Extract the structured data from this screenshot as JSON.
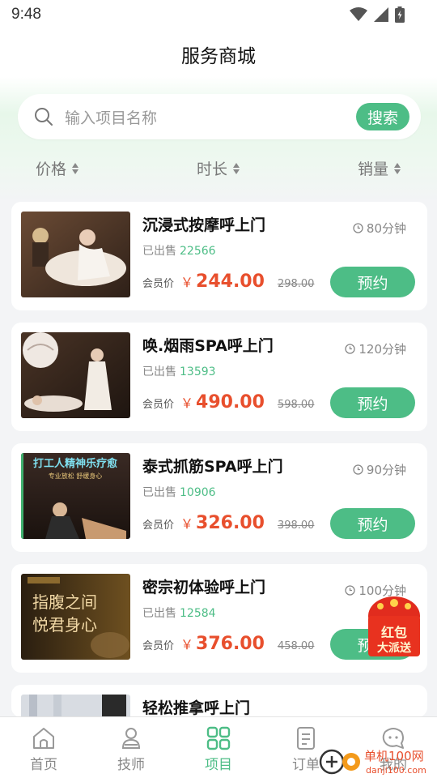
{
  "status": {
    "time": "9:48"
  },
  "header": {
    "title": "服务商城"
  },
  "search": {
    "placeholder": "输入项目名称",
    "button": "搜索"
  },
  "sort": [
    {
      "label": "价格"
    },
    {
      "label": "时长"
    },
    {
      "label": "销量"
    }
  ],
  "cards": [
    {
      "title": "沉浸式按摩呼上门",
      "duration": "80分钟",
      "sold_label": "已出售",
      "sold": "22566",
      "member_label": "会员价",
      "currency": "￥",
      "price": "244.00",
      "original": "298.00",
      "button": "预约"
    },
    {
      "title": "唤.烟雨SPA呼上门",
      "duration": "120分钟",
      "sold_label": "已出售",
      "sold": "13593",
      "member_label": "会员价",
      "currency": "￥",
      "price": "490.00",
      "original": "598.00",
      "button": "预约"
    },
    {
      "title": "泰式抓筋SPA呼上门",
      "duration": "90分钟",
      "sold_label": "已出售",
      "sold": "10906",
      "member_label": "会员价",
      "currency": "￥",
      "price": "326.00",
      "original": "398.00",
      "button": "预约",
      "image_text": [
        "打工人精神乐疗愈",
        "专业放松 舒缓身心"
      ]
    },
    {
      "title": "密宗初体验呼上门",
      "duration": "100分钟",
      "sold_label": "已出售",
      "sold": "12584",
      "member_label": "会员价",
      "currency": "￥",
      "price": "376.00",
      "original": "458.00",
      "button": "预约",
      "image_text": [
        "指腹之间",
        "悦君身心"
      ]
    },
    {
      "title": "轻松推拿呼上门"
    }
  ],
  "redpacket": {
    "line1": "红包",
    "line2": "大派送"
  },
  "tabs": [
    {
      "label": "首页",
      "icon": "home-icon"
    },
    {
      "label": "技师",
      "icon": "technician-icon"
    },
    {
      "label": "项目",
      "icon": "grid-icon"
    },
    {
      "label": "订单",
      "icon": "order-icon"
    },
    {
      "label": "我的",
      "icon": "profile-icon"
    }
  ],
  "watermark": {
    "text": "单机100网",
    "url": "danji100.com"
  },
  "colors": {
    "accent": "#4dbd86",
    "price": "#e84f2d"
  }
}
